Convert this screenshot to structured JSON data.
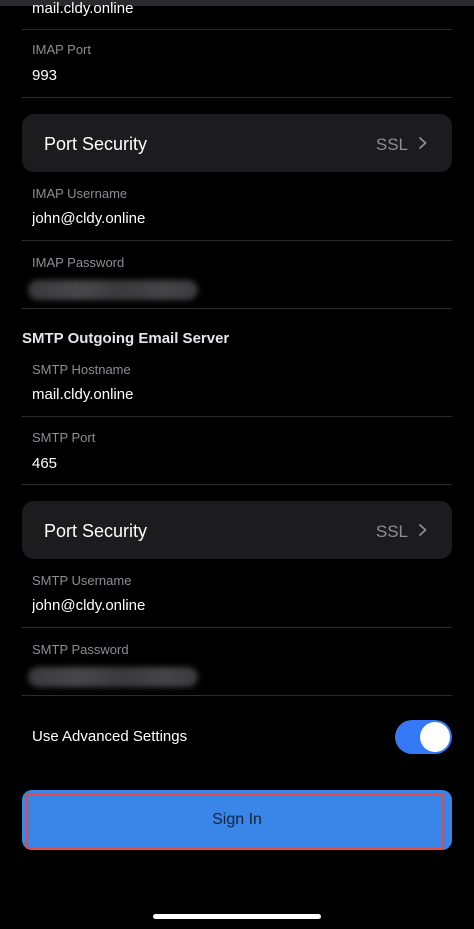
{
  "incoming": {
    "hostname_value": "mail.cldy.online",
    "port_label": "IMAP Port",
    "port_value": "993",
    "security_label": "Port Security",
    "security_value": "SSL",
    "username_label": "IMAP Username",
    "username_value": "john@cldy.online",
    "password_label": "IMAP Password"
  },
  "outgoing": {
    "section_title": "SMTP Outgoing Email Server",
    "hostname_label": "SMTP Hostname",
    "hostname_value": "mail.cldy.online",
    "port_label": "SMTP Port",
    "port_value": "465",
    "security_label": "Port Security",
    "security_value": "SSL",
    "username_label": "SMTP Username",
    "username_value": "john@cldy.online",
    "password_label": "SMTP Password"
  },
  "advanced": {
    "label": "Use Advanced Settings",
    "enabled": true
  },
  "signin_label": "Sign In",
  "icons": {
    "chevron": "chevron-right-icon"
  },
  "colors": {
    "accent": "#3478f6",
    "signin_bg": "#3a86e8",
    "highlight_border": "#e24a4a",
    "cell_bg": "#1c1c1e"
  }
}
